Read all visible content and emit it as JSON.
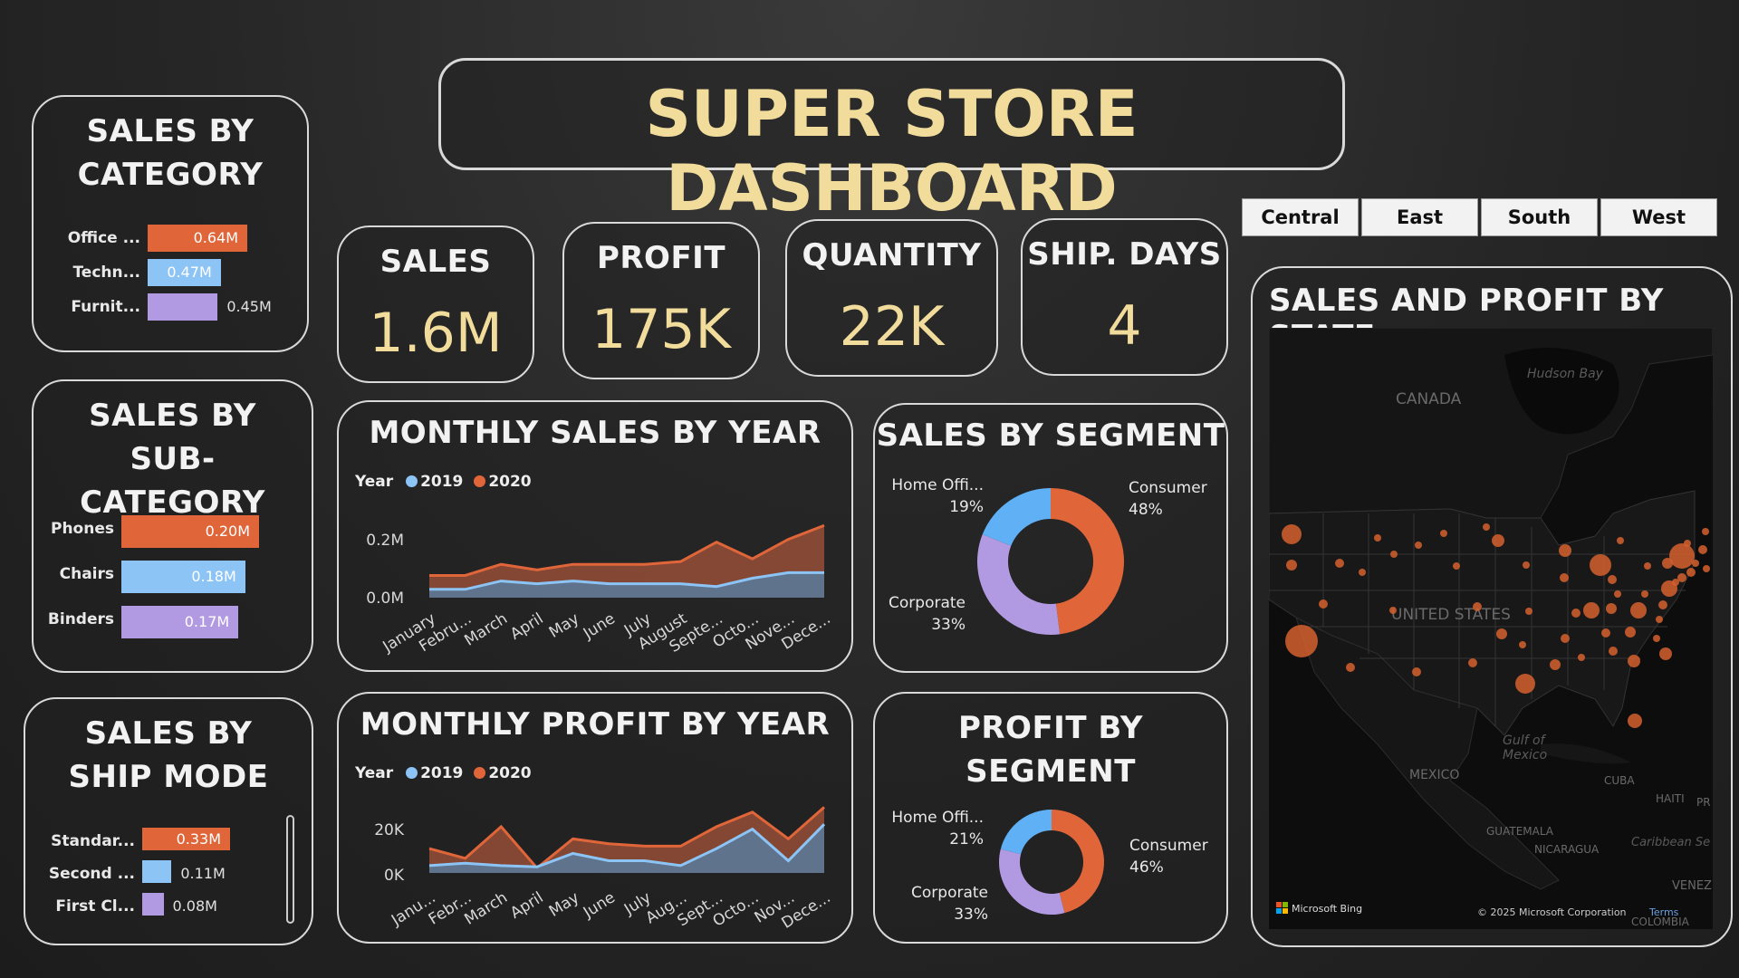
{
  "title": "SUPER STORE DASHBOARD",
  "colors": {
    "orange": "#e0663a",
    "blue": "#8cc4f5",
    "purple": "#b29ae3",
    "gold": "#f1dc9c"
  },
  "kpis": [
    {
      "label": "SALES",
      "value": "1.6M"
    },
    {
      "label": "PROFIT",
      "value": "175K"
    },
    {
      "label": "QUANTITY",
      "value": "22K"
    },
    {
      "label": "SHIP. DAYS",
      "value": "4"
    }
  ],
  "regions": [
    "Central",
    "East",
    "South",
    "West"
  ],
  "sales_by_category": {
    "title": "SALES BY CATEGORY",
    "items": [
      {
        "label": "Office ...",
        "value": 0.64,
        "display": "0.64M",
        "color": "#e0663a"
      },
      {
        "label": "Techn...",
        "value": 0.47,
        "display": "0.47M",
        "color": "#8cc4f5"
      },
      {
        "label": "Furnit...",
        "value": 0.45,
        "display": "0.45M",
        "color": "#b29ae3"
      }
    ]
  },
  "sales_by_subcategory": {
    "title": "SALES BY SUB-CATEGORY",
    "items": [
      {
        "label": "Phones",
        "value": 0.2,
        "display": "0.20M",
        "color": "#e0663a"
      },
      {
        "label": "Chairs",
        "value": 0.18,
        "display": "0.18M",
        "color": "#8cc4f5"
      },
      {
        "label": "Binders",
        "value": 0.17,
        "display": "0.17M",
        "color": "#b29ae3"
      }
    ]
  },
  "sales_by_ship_mode": {
    "title": "SALES BY SHIP MODE",
    "items": [
      {
        "label": "Standar...",
        "value": 0.33,
        "display": "0.33M",
        "color": "#e0663a"
      },
      {
        "label": "Second ...",
        "value": 0.11,
        "display": "0.11M",
        "color": "#8cc4f5"
      },
      {
        "label": "First Cl...",
        "value": 0.08,
        "display": "0.08M",
        "color": "#b29ae3"
      }
    ]
  },
  "monthly_sales": {
    "title": "MONTHLY SALES BY YEAR",
    "legend_title": "Year",
    "y_ticks": [
      "0.2M",
      "0.0M"
    ],
    "months": [
      "January",
      "Febru...",
      "March",
      "April",
      "May",
      "June",
      "July",
      "August",
      "Septe...",
      "Octo...",
      "Nove...",
      "Dece..."
    ]
  },
  "monthly_profit": {
    "title": "MONTHLY PROFIT BY YEAR",
    "legend_title": "Year",
    "y_ticks": [
      "20K",
      "0K"
    ],
    "months": [
      "Janu...",
      "Febr...",
      "March",
      "April",
      "May",
      "June",
      "July",
      "Aug...",
      "Sept...",
      "Octo...",
      "Nov...",
      "Dece..."
    ]
  },
  "sales_by_segment": {
    "title": "SALES BY SEGMENT",
    "labels": {
      "home": "Home Offi...",
      "home_pct": "19%",
      "consumer": "Consumer",
      "consumer_pct": "48%",
      "corporate": "Corporate",
      "corporate_pct": "33%"
    }
  },
  "profit_by_segment": {
    "title": "PROFIT BY SEGMENT",
    "labels": {
      "home": "Home Offi...",
      "home_pct": "21%",
      "consumer": "Consumer",
      "consumer_pct": "46%",
      "corporate": "Corporate",
      "corporate_pct": "33%"
    }
  },
  "map": {
    "title": "SALES AND PROFIT BY STATE",
    "labels": {
      "hudson": "Hudson Bay",
      "canada": "CANADA",
      "us": "UNITED STATES",
      "gulf": "Gulf of",
      "gulf2": "Mexico",
      "mexico": "MEXICO",
      "cuba": "CUBA",
      "haiti": "HAITI",
      "guatemala": "GUATEMALA",
      "nicaragua": "NICARAGUA",
      "caribbean": "Caribbean Se",
      "venez": "VENEZ",
      "colombia": "COLOMBIA",
      "pr": "PR"
    },
    "bing": "Microsoft Bing",
    "copyright": "© 2025 Microsoft Corporation",
    "terms": "Terms"
  },
  "chart_data": [
    {
      "type": "area",
      "title": "MONTHLY SALES BY YEAR",
      "categories": [
        "January",
        "Febru...",
        "March",
        "April",
        "May",
        "June",
        "July",
        "August",
        "Septe...",
        "Octo...",
        "Nove...",
        "Dece..."
      ],
      "series": [
        {
          "name": "2019",
          "values": [
            0.03,
            0.03,
            0.06,
            0.05,
            0.06,
            0.05,
            0.05,
            0.05,
            0.04,
            0.07,
            0.09,
            0.09
          ]
        },
        {
          "name": "2020",
          "values": [
            0.08,
            0.08,
            0.12,
            0.1,
            0.12,
            0.12,
            0.12,
            0.13,
            0.2,
            0.14,
            0.21,
            0.26
          ]
        }
      ],
      "ylim": [
        0,
        0.3
      ]
    },
    {
      "type": "area",
      "title": "MONTHLY PROFIT BY YEAR",
      "categories": [
        "Janu...",
        "Febr...",
        "March",
        "April",
        "May",
        "June",
        "July",
        "Aug...",
        "Sept...",
        "Octo...",
        "Nov...",
        "Dece..."
      ],
      "series": [
        {
          "name": "2019",
          "values": [
            3000,
            4000,
            3000,
            2500,
            8000,
            5000,
            5000,
            3000,
            10000,
            18000,
            5000,
            20000
          ]
        },
        {
          "name": "2020",
          "values": [
            10000,
            6000,
            19000,
            2000,
            14000,
            12000,
            11000,
            11000,
            19000,
            25000,
            14000,
            27000
          ]
        }
      ],
      "ylim": [
        -3000,
        32000
      ]
    },
    {
      "type": "pie",
      "title": "SALES BY SEGMENT",
      "categories": [
        "Consumer",
        "Corporate",
        "Home Offi..."
      ],
      "values": [
        48,
        33,
        19
      ]
    },
    {
      "type": "pie",
      "title": "PROFIT BY SEGMENT",
      "categories": [
        "Consumer",
        "Corporate",
        "Home Offi..."
      ],
      "values": [
        46,
        33,
        21
      ]
    }
  ]
}
